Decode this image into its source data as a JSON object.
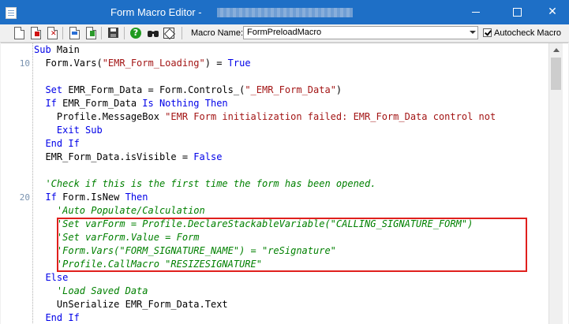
{
  "window": {
    "title": "Form Macro Editor -",
    "minimize_glyph": "",
    "close_glyph": "✕"
  },
  "toolbar": {
    "icons": [
      "new-document-icon",
      "new-document-red-icon",
      "delete-document-icon",
      "import-icon",
      "export-icon",
      "save-icon",
      "help-icon",
      "find-icon",
      "print-icon"
    ],
    "macro_name_label": "Macro Name:",
    "macro_name_value": "FormPreloadMacro",
    "autocheck_label": "Autocheck Macro",
    "autocheck_checked": true
  },
  "editor": {
    "line_numbers": {
      "1": "10",
      "11": "20"
    },
    "lines": [
      [
        [
          "kw",
          "Sub "
        ],
        [
          "txt",
          "Main"
        ]
      ],
      [
        [
          "txt",
          "  Form.Vars("
        ],
        [
          "str",
          "\"EMR_Form_Loading\""
        ],
        [
          "txt",
          ") = "
        ],
        [
          "kw",
          "True"
        ]
      ],
      [],
      [
        [
          "kw",
          "  Set "
        ],
        [
          "txt",
          "EMR_Form_Data = Form.Controls_("
        ],
        [
          "str",
          "\"_EMR_Form_Data\""
        ],
        [
          "txt",
          ")"
        ]
      ],
      [
        [
          "kw",
          "  If "
        ],
        [
          "txt",
          "EMR_Form_Data "
        ],
        [
          "kw",
          "Is Nothing Then"
        ]
      ],
      [
        [
          "txt",
          "    Profile.MessageBox "
        ],
        [
          "str",
          "\"EMR Form initialization failed: EMR_Form_Data control not"
        ]
      ],
      [
        [
          "kw",
          "    Exit Sub"
        ]
      ],
      [
        [
          "kw",
          "  End If"
        ]
      ],
      [
        [
          "txt",
          "  EMR_Form_Data.isVisible = "
        ],
        [
          "kw",
          "False"
        ]
      ],
      [],
      [
        [
          "cm",
          "  'Check if this is the first time the form has been opened."
        ]
      ],
      [
        [
          "kw",
          "  If "
        ],
        [
          "txt",
          "Form.IsNew "
        ],
        [
          "kw",
          "Then"
        ]
      ],
      [
        [
          "cm",
          "    'Auto Populate/Calculation"
        ]
      ],
      [
        [
          "cm",
          "    'Set varForm = Profile.DeclareStackableVariable(\"CALLING_SIGNATURE_FORM\")"
        ]
      ],
      [
        [
          "cm",
          "    'Set varForm.Value = Form"
        ]
      ],
      [
        [
          "cm",
          "    'Form.Vars(\"FORM_SIGNATURE_NAME\") = \"reSignature\""
        ]
      ],
      [
        [
          "cm",
          "    'Profile.CallMacro \"RESIZESIGNATURE\""
        ]
      ],
      [
        [
          "kw",
          "  Else"
        ]
      ],
      [
        [
          "cm",
          "    'Load Saved Data"
        ]
      ],
      [
        [
          "txt",
          "    UnSerialize EMR_Form_Data.Text"
        ]
      ],
      [
        [
          "kw",
          "  End If"
        ]
      ]
    ]
  }
}
